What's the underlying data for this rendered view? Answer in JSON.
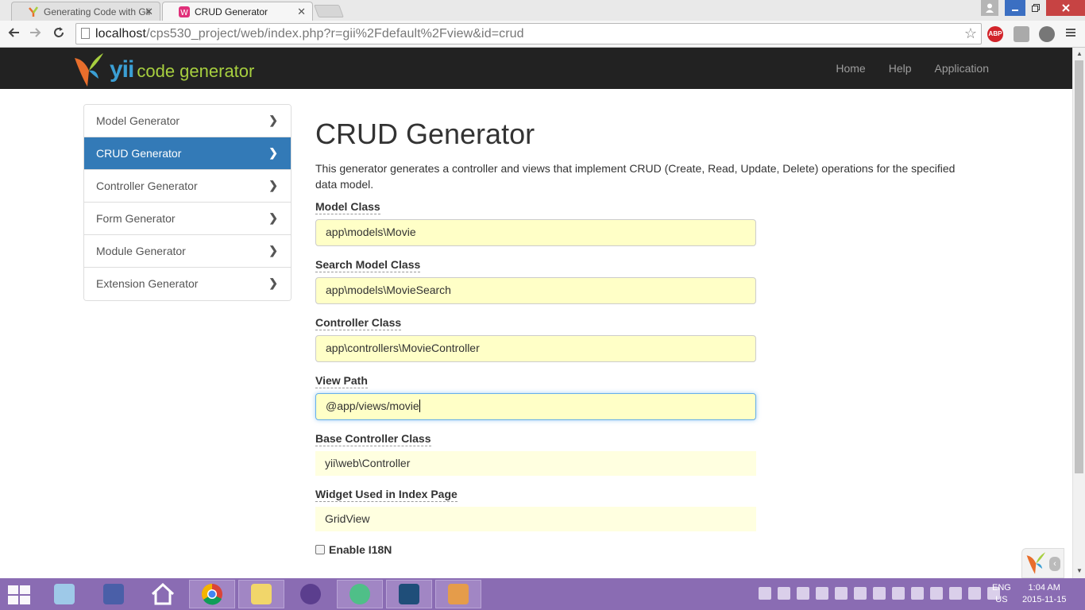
{
  "browser": {
    "tabs": [
      {
        "title": "Generating Code with Gii",
        "active": false
      },
      {
        "title": "CRUD Generator",
        "active": true
      }
    ],
    "close_glyph": "✕",
    "url_host": "localhost",
    "url_path": "/cps530_project/web/index.php?r=gii%2Fdefault%2Fview&id=crud",
    "abp_label": "ABP"
  },
  "navbar": {
    "brand_yii": "yii",
    "brand_rest": "code generator",
    "links": [
      "Home",
      "Help",
      "Application"
    ]
  },
  "sidebar": {
    "items": [
      {
        "label": "Model Generator",
        "active": false
      },
      {
        "label": "CRUD Generator",
        "active": true
      },
      {
        "label": "Controller Generator",
        "active": false
      },
      {
        "label": "Form Generator",
        "active": false
      },
      {
        "label": "Module Generator",
        "active": false
      },
      {
        "label": "Extension Generator",
        "active": false
      }
    ],
    "chevron": "❯"
  },
  "main": {
    "title": "CRUD Generator",
    "description": "This generator generates a controller and views that implement CRUD (Create, Read, Update, Delete) operations for the specified data model.",
    "fields": [
      {
        "label": "Model Class",
        "value": "app\\models\\Movie"
      },
      {
        "label": "Search Model Class",
        "value": "app\\models\\MovieSearch"
      },
      {
        "label": "Controller Class",
        "value": "app\\controllers\\MovieController"
      },
      {
        "label": "View Path",
        "value": "@app/views/movie",
        "focused": true
      },
      {
        "label": "Base Controller Class",
        "value": "yii\\web\\Controller"
      },
      {
        "label": "Widget Used in Index Page",
        "value": "GridView"
      }
    ],
    "checkbox_label": "Enable I18N"
  },
  "taskbar": {
    "language": "ENG",
    "region": "US",
    "time": "1:04 AM",
    "date": "2015-11-15"
  },
  "colors": {
    "accent": "#337ab7",
    "navbar_bg": "#222222",
    "field_bg": "#ffffc7",
    "taskbar_bg": "#8a6cb3"
  }
}
